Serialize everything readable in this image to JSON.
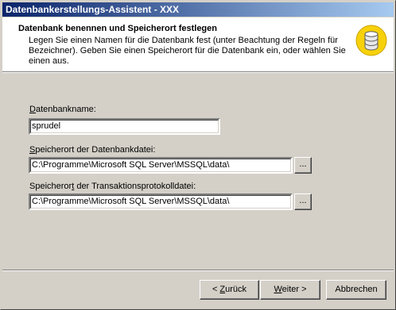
{
  "window": {
    "title": "Datenbankerstellungs-Assistent - XXX"
  },
  "header": {
    "title": "Datenbank benennen und Speicherort festlegen",
    "description": "Legen Sie einen Namen für die Datenbank fest (unter Beachtung der Regeln für Bezeichner). Geben Sie einen Speicherort für die Datenbank ein, oder wählen Sie einen aus.",
    "icon": "database-icon"
  },
  "form": {
    "db_name": {
      "label_accel": "D",
      "label_rest": "atenbankname:",
      "value": "sprudel"
    },
    "data_file": {
      "label_accel": "S",
      "label_rest": "peicherort der Datenbankdatei:",
      "value": "C:\\Programme\\Microsoft SQL Server\\MSSQL\\data\\",
      "browse_label": "..."
    },
    "log_file": {
      "label_pre": "Speicheror",
      "label_accel": "t",
      "label_rest": " der Transaktionsprotokolldatei:",
      "value": "C:\\Programme\\Microsoft SQL Server\\MSSQL\\data\\",
      "browse_label": "..."
    }
  },
  "buttons": {
    "back_pre": "< ",
    "back_accel": "Z",
    "back_rest": "urück",
    "next_accel": "W",
    "next_rest": "eiter >",
    "cancel": "Abbrechen"
  },
  "colors": {
    "titlebar_start": "#0a246a",
    "titlebar_end": "#a6caf0",
    "dialog_bg": "#d4d0c8",
    "icon_yellow": "#f7d10a"
  }
}
